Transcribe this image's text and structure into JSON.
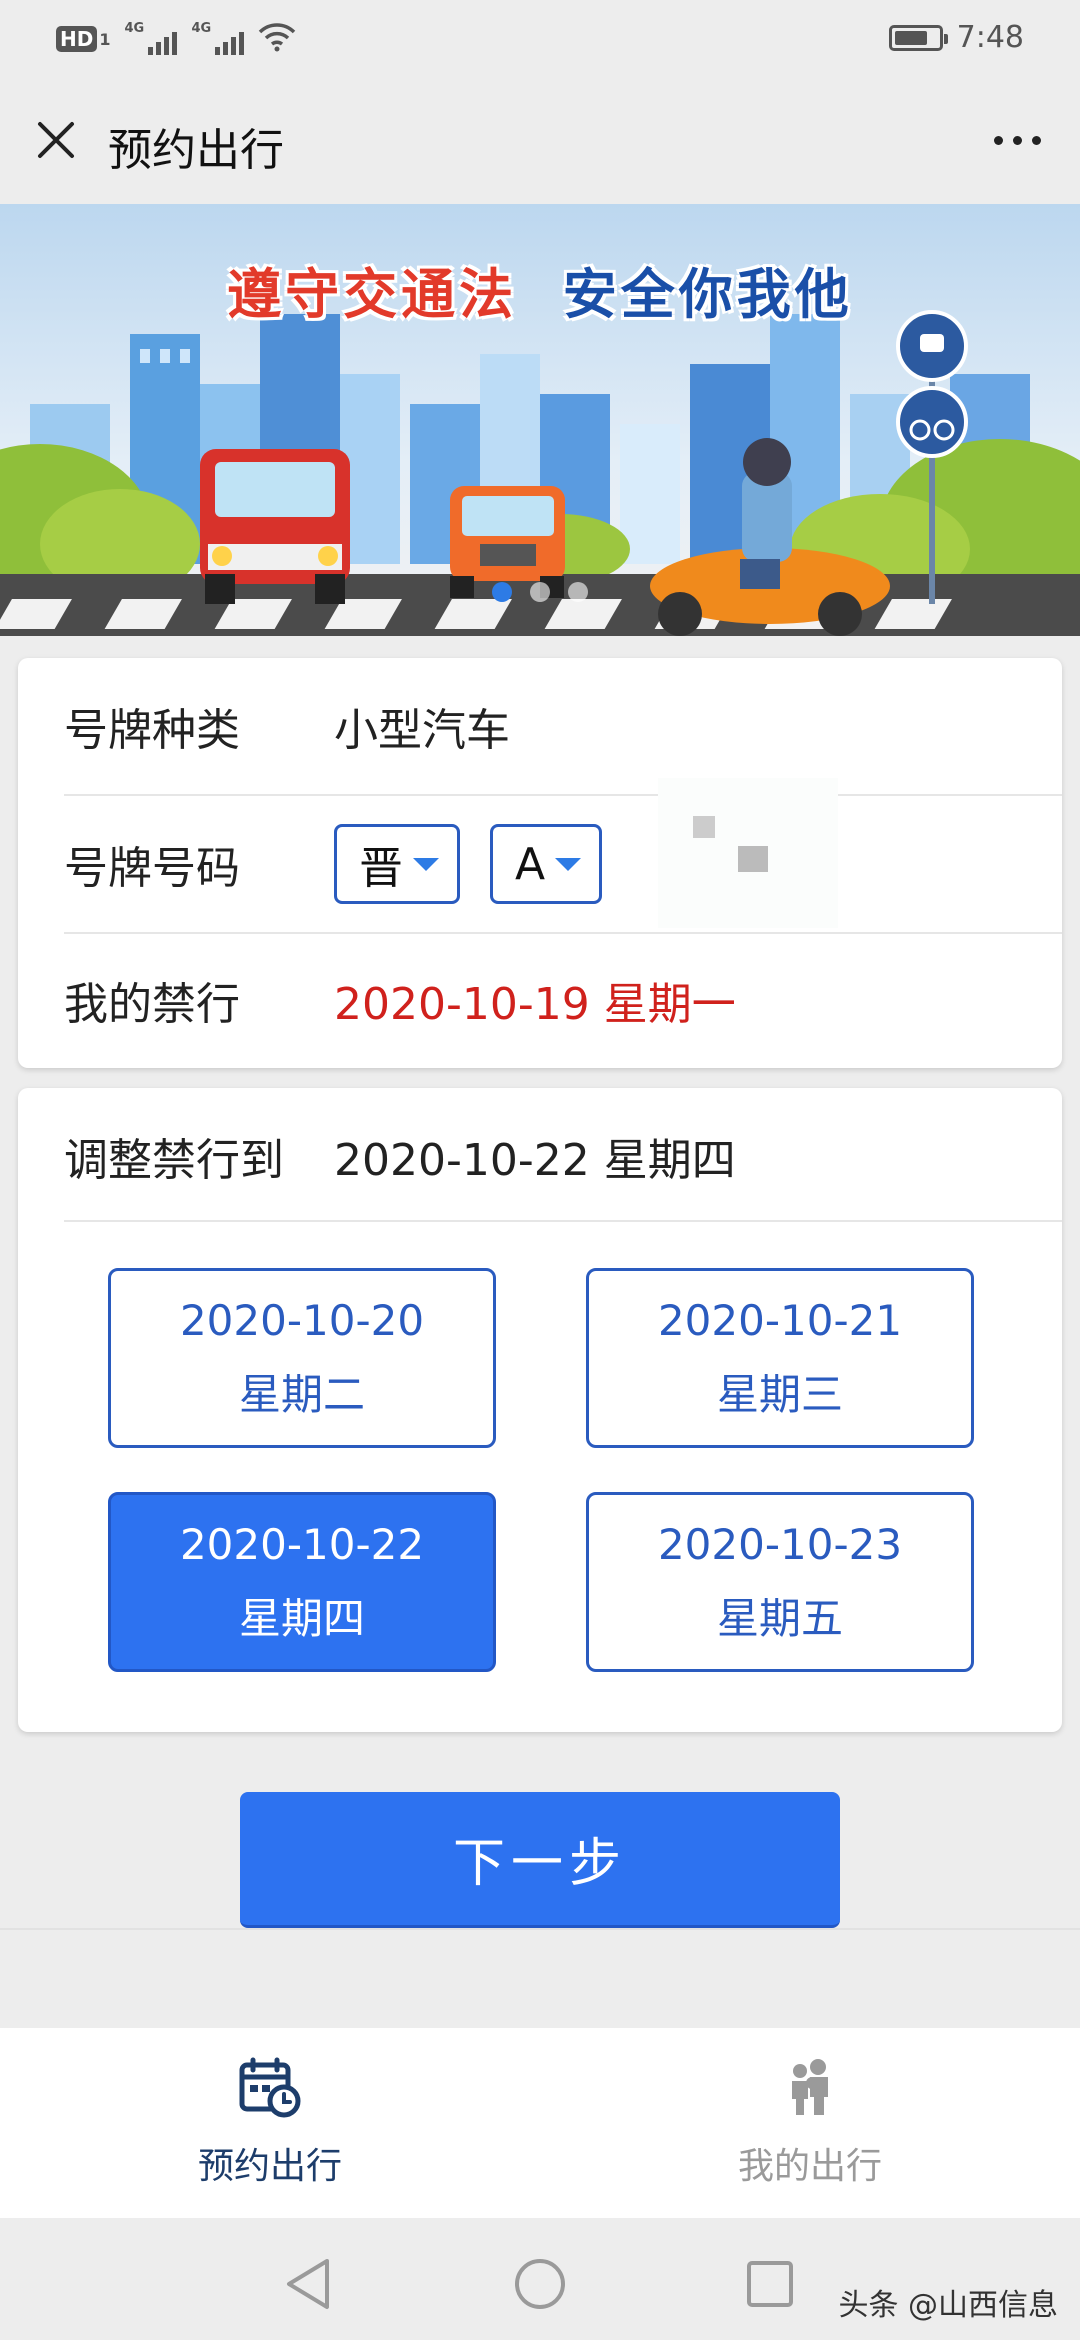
{
  "status_bar": {
    "hd": "HD",
    "hd_sub": "1",
    "net1": "4G",
    "net2": "4G",
    "time": "7:48",
    "battery_level": 0.75
  },
  "nav": {
    "title": "预约出行",
    "close_icon": "close-icon",
    "more_icon": "more-icon"
  },
  "banner": {
    "slogan_part1": "遵守交通法",
    "slogan_part2": "安全你我他",
    "slide_count": 3,
    "active_slide": 1
  },
  "vehicle": {
    "plate_type_label": "号牌种类",
    "plate_type_value": "小型汽车",
    "plate_number_label": "号牌号码",
    "province": "晋",
    "letter": "A",
    "my_ban_label": "我的禁行",
    "my_ban_value": "2020-10-19 星期一"
  },
  "adjust": {
    "label": "调整禁行到",
    "value": "2020-10-22 星期四",
    "options": [
      {
        "date": "2020-10-20",
        "weekday": "星期二",
        "selected": false
      },
      {
        "date": "2020-10-21",
        "weekday": "星期三",
        "selected": false
      },
      {
        "date": "2020-10-22",
        "weekday": "星期四",
        "selected": true
      },
      {
        "date": "2020-10-23",
        "weekday": "星期五",
        "selected": false
      }
    ]
  },
  "next_button": "下一步",
  "tabs": [
    {
      "label": "预约出行",
      "icon": "calendar-clock-icon",
      "active": true
    },
    {
      "label": "我的出行",
      "icon": "people-icon",
      "active": false
    }
  ],
  "system_nav": {
    "watermark": "头条 @山西信息"
  },
  "colors": {
    "primary": "#2d72f0",
    "border_blue": "#2a5bbf",
    "alert_red": "#d0211c",
    "active_tab": "#1d3d6b"
  }
}
